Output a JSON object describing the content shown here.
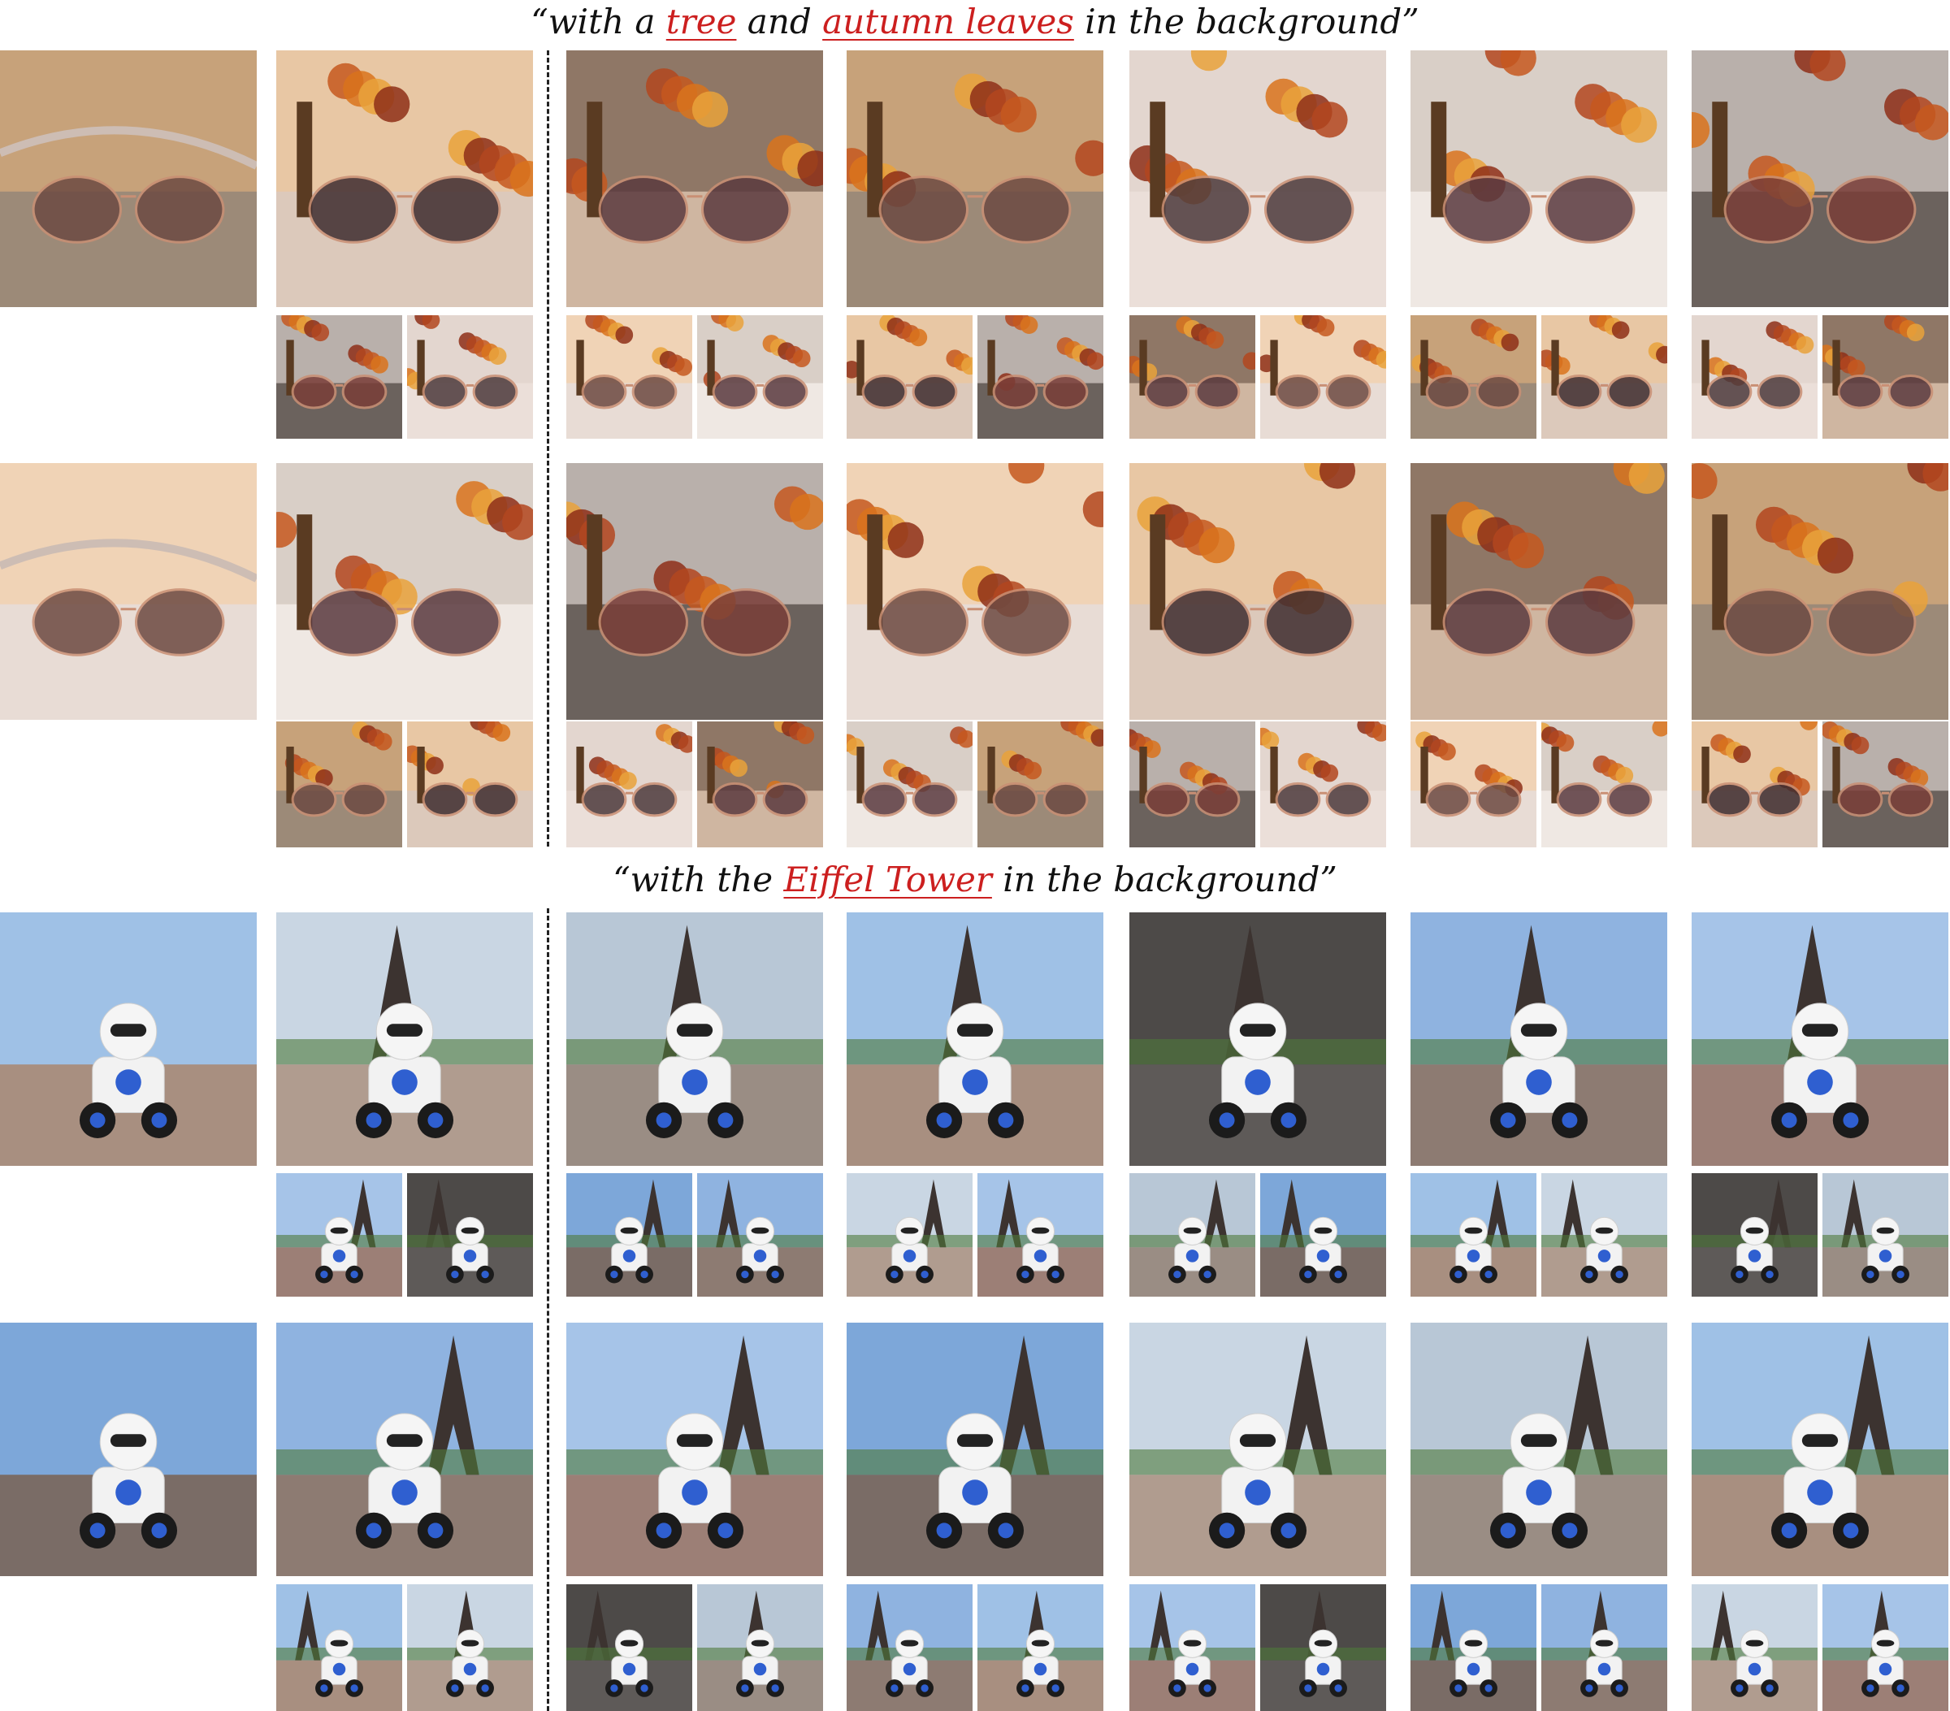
{
  "captions": [
    {
      "prefix": "“with a ",
      "hl1": "tree",
      "mid": " and ",
      "hl2": "autumn leaves",
      "suffix": " in the background”"
    },
    {
      "prefix": "“with the ",
      "hl1": "Eiffel Tower",
      "suffix": " in the background”"
    }
  ],
  "colors": {
    "highlight": "#cc1f1f",
    "text": "#111111",
    "divider": "#222222"
  },
  "icons": [
    "sunglasses-photo",
    "toy-robot-photo",
    "autumn-tree",
    "eiffel-tower"
  ]
}
